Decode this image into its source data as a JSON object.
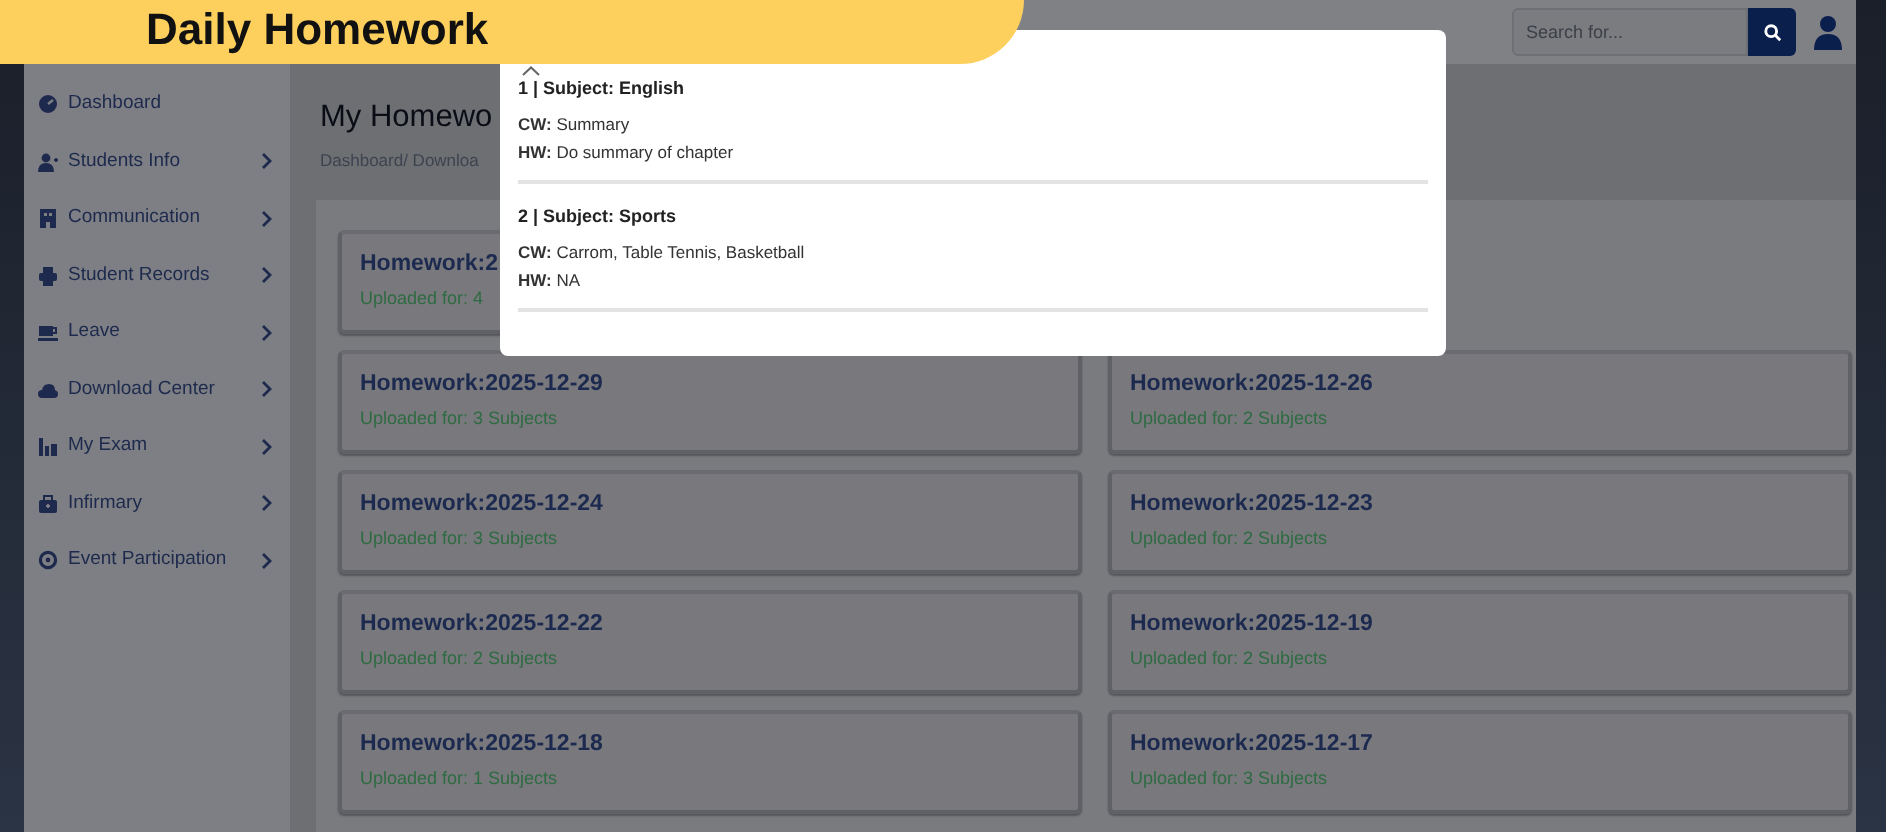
{
  "banner": {
    "title": "Daily Homework"
  },
  "topbar": {
    "search": {
      "placeholder": "Search for..."
    }
  },
  "sidebar": {
    "items": [
      {
        "label": "Dashboard",
        "expandable": false
      },
      {
        "label": "Students Info",
        "expandable": true
      },
      {
        "label": "Communication",
        "expandable": true
      },
      {
        "label": "Student Records",
        "expandable": true
      },
      {
        "label": "Leave",
        "expandable": true
      },
      {
        "label": "Download Center",
        "expandable": true
      },
      {
        "label": "My Exam",
        "expandable": true
      },
      {
        "label": "Infirmary",
        "expandable": true
      },
      {
        "label": "Event Participation",
        "expandable": true
      }
    ]
  },
  "page": {
    "title": "My Homewo",
    "breadcrumb": "Dashboard/ Downloa"
  },
  "homework_cards": [
    {
      "title": "Homework:2",
      "subtitle": "Uploaded for: 4"
    },
    {
      "title": "Homework:2025-12-29",
      "subtitle": "Uploaded for: 3 Subjects"
    },
    {
      "title": "Homework:2025-12-26",
      "subtitle": "Uploaded for: 2 Subjects"
    },
    {
      "title": "Homework:2025-12-24",
      "subtitle": "Uploaded for: 3 Subjects"
    },
    {
      "title": "Homework:2025-12-23",
      "subtitle": "Uploaded for: 2 Subjects"
    },
    {
      "title": "Homework:2025-12-22",
      "subtitle": "Uploaded for: 2 Subjects"
    },
    {
      "title": "Homework:2025-12-19",
      "subtitle": "Uploaded for: 2 Subjects"
    },
    {
      "title": "Homework:2025-12-18",
      "subtitle": "Uploaded for: 1 Subjects"
    },
    {
      "title": "Homework:2025-12-17",
      "subtitle": "Uploaded for: 3 Subjects"
    }
  ],
  "popup": {
    "entries": [
      {
        "heading": "1 | Subject: English",
        "lines": [
          "**CW:** Summary",
          "**HW:** Do summary of chapter"
        ]
      },
      {
        "heading": "2 | Subject: Sports",
        "lines": [
          "**CW:** Carrom, Table Tennis, Basketball",
          "**HW:** NA"
        ]
      }
    ]
  }
}
